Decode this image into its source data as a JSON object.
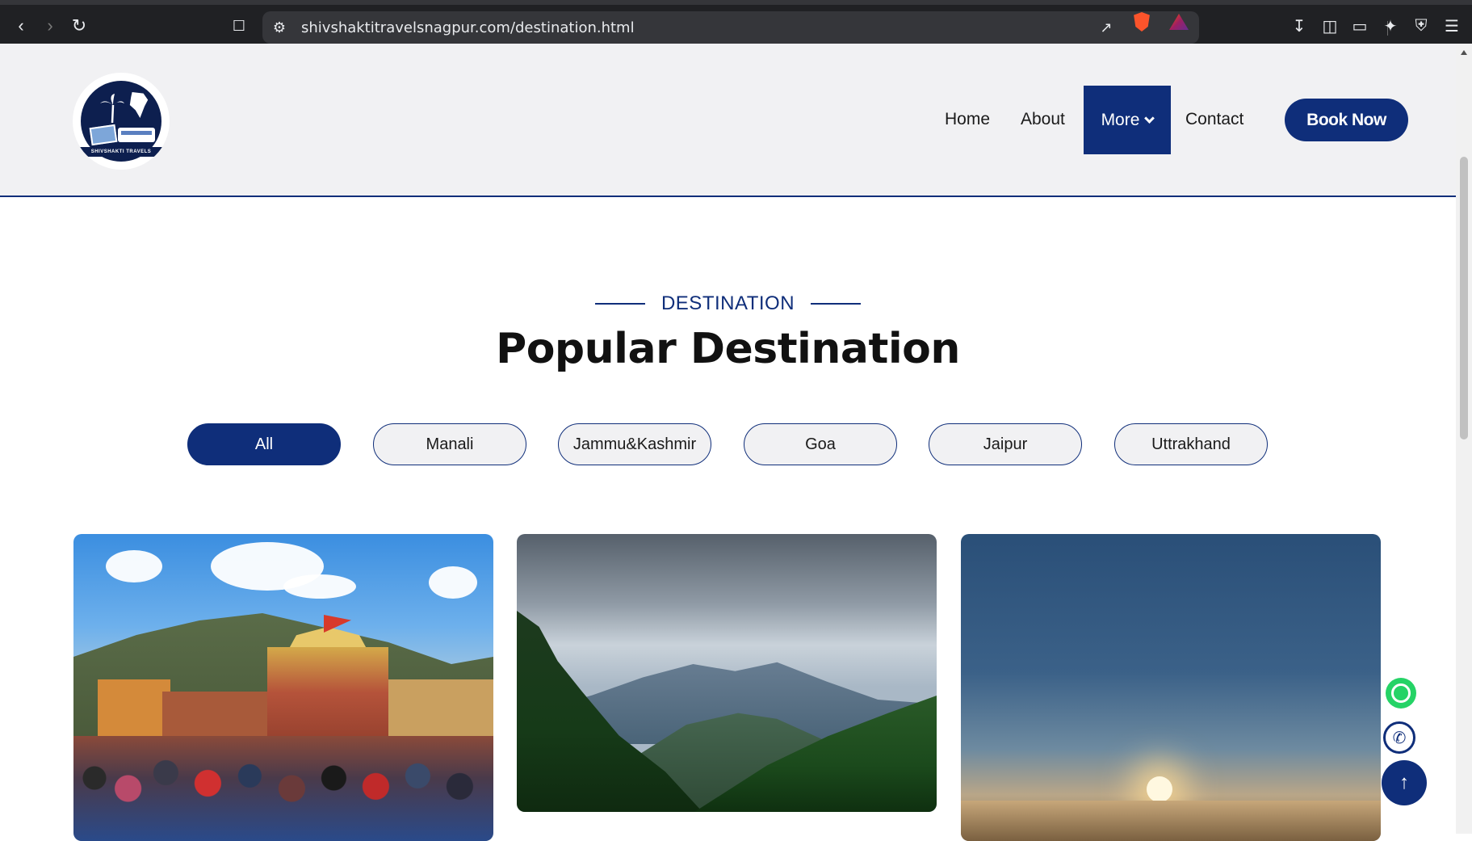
{
  "browser": {
    "url": "shivshaktitravelsnagpur.com/destination.html",
    "icons": [
      "back-icon",
      "forward-icon",
      "reload-icon",
      "bookmark-icon",
      "site-settings-icon",
      "share-icon",
      "brave-shields-icon",
      "brave-rewards-icon",
      "download-icon",
      "sidebar-icon",
      "wallet-icon",
      "leo-icon",
      "vpn-icon",
      "menu-icon"
    ]
  },
  "header": {
    "logo_text": "SHIVSHAKTI TRAVELS",
    "nav": [
      "Home",
      "About",
      "More",
      "Contact"
    ],
    "book_label": "Book Now"
  },
  "section": {
    "kicker": "DESTINATION",
    "title": "Popular Destination"
  },
  "filters": [
    "All",
    "Manali",
    "Jammu&Kashmir",
    "Goa",
    "Jaipur",
    "Uttrakhand"
  ],
  "active_filter": "All",
  "cards": [
    {
      "image": "temple-crowd-photo"
    },
    {
      "image": "mountain-valley-photo"
    },
    {
      "image": "sunrise-clouds-photo"
    }
  ],
  "floating": [
    "whatsapp-icon",
    "phone-icon",
    "arrow-up-icon"
  ],
  "colors": {
    "brand": "#0f2e7a",
    "header_bg": "#f1f1f3",
    "browser_bg": "#202124"
  }
}
